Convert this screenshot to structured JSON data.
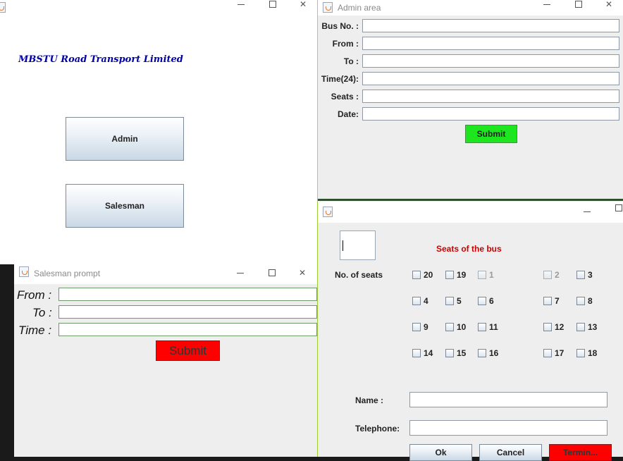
{
  "main": {
    "heading": "MBSTU Road Transport Limited",
    "admin_label": "Admin",
    "salesman_label": "Salesman"
  },
  "admin": {
    "title": "Admin area",
    "labels": [
      "Bus No. :",
      "From :",
      "To :",
      "Time(24):",
      "Seats :",
      "Date:"
    ],
    "values": [
      "",
      "",
      "",
      "",
      "",
      ""
    ],
    "submit_label": "Submit",
    "submit_color": "#1ee61e"
  },
  "salesman": {
    "title": "Salesman prompt",
    "labels": [
      "From :",
      "To :",
      "Time :"
    ],
    "submit_label": "Submit",
    "submit_color": "#ff0000"
  },
  "seats": {
    "heading": "Seats of the bus",
    "heading_color": "#cc0000",
    "count_label": "No. of seats",
    "rows": [
      [
        {
          "n": "20",
          "enabled": true
        },
        {
          "n": "19",
          "enabled": true
        },
        {
          "n": "1",
          "enabled": false
        },
        {
          "n": "2",
          "enabled": false
        },
        {
          "n": "3",
          "enabled": true
        }
      ],
      [
        {
          "n": "4",
          "enabled": true
        },
        {
          "n": "5",
          "enabled": true
        },
        {
          "n": "6",
          "enabled": true
        },
        {
          "n": "7",
          "enabled": true
        },
        {
          "n": "8",
          "enabled": true
        }
      ],
      [
        {
          "n": "9",
          "enabled": true
        },
        {
          "n": "10",
          "enabled": true
        },
        {
          "n": "11",
          "enabled": true
        },
        {
          "n": "12",
          "enabled": true
        },
        {
          "n": "13",
          "enabled": true
        }
      ],
      [
        {
          "n": "14",
          "enabled": true
        },
        {
          "n": "15",
          "enabled": true
        },
        {
          "n": "16",
          "enabled": true
        },
        {
          "n": "17",
          "enabled": true
        },
        {
          "n": "18",
          "enabled": true
        }
      ]
    ],
    "name_label": "Name :",
    "phone_label": "Telephone:",
    "ok_label": "Ok",
    "cancel_label": "Cancel",
    "terminate_label": "Termin...",
    "terminate_color": "#ff0000"
  }
}
